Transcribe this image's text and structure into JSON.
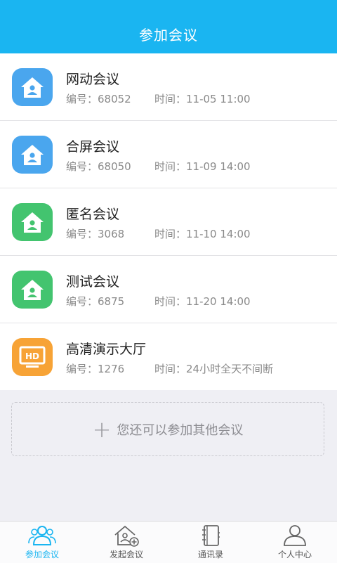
{
  "header": {
    "title": "参加会议"
  },
  "colors": {
    "accent": "#1ab5f1",
    "blue_icon": "#4aa6ee",
    "green_icon": "#43c46f",
    "orange_icon": "#f7a336"
  },
  "meetings": [
    {
      "name": "网动会议",
      "id_label": "编号：68052",
      "time_label": "时间：11-05 11:00",
      "icon": "house-icon",
      "color": "blue"
    },
    {
      "name": "合屏会议",
      "id_label": "编号：68050",
      "time_label": "时间：11-09 14:00",
      "icon": "house-icon",
      "color": "blue"
    },
    {
      "name": "匿名会议",
      "id_label": "编号：3068",
      "time_label": "时间：11-10 14:00",
      "icon": "house-icon",
      "color": "green"
    },
    {
      "name": "测试会议",
      "id_label": "编号：6875",
      "time_label": "时间：11-20 14:00",
      "icon": "house-icon",
      "color": "green"
    },
    {
      "name": "高清演示大厅",
      "id_label": "编号：1276",
      "time_label": "时间：24小时全天不间断",
      "icon": "hd-monitor-icon",
      "color": "orange"
    }
  ],
  "add_more": {
    "plus": "+",
    "label": "您还可以参加其他会议"
  },
  "tabs": [
    {
      "label": "参加会议",
      "icon": "people-icon",
      "active": true
    },
    {
      "label": "发起会议",
      "icon": "house-add-icon",
      "active": false
    },
    {
      "label": "通讯录",
      "icon": "address-book-icon",
      "active": false
    },
    {
      "label": "个人中心",
      "icon": "person-icon",
      "active": false
    }
  ]
}
